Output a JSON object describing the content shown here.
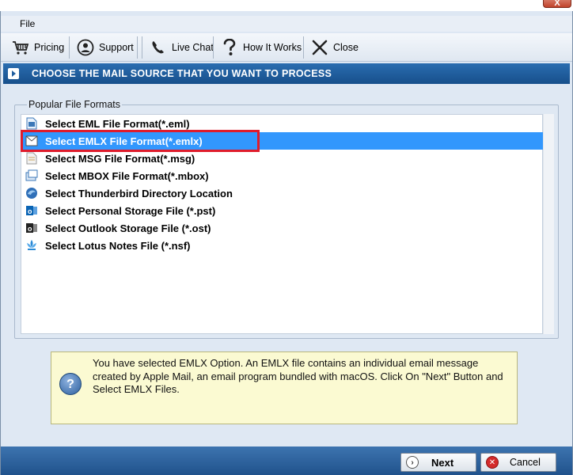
{
  "window": {
    "close_glyph": "X"
  },
  "menu": {
    "file": "File"
  },
  "toolbar": {
    "pricing": "Pricing",
    "support": "Support",
    "live_chat": "Live Chat",
    "how_it_works": "How It Works",
    "close": "Close"
  },
  "header": {
    "title": "CHOOSE THE MAIL SOURCE THAT YOU WANT TO PROCESS"
  },
  "group": {
    "title": "Popular File Formats"
  },
  "formats": [
    {
      "label": "Select EML File Format(*.eml)",
      "icon": "eml-file-icon",
      "selected": false
    },
    {
      "label": "Select EMLX File Format(*.emlx)",
      "icon": "emlx-file-icon",
      "selected": true
    },
    {
      "label": "Select MSG File Format(*.msg)",
      "icon": "msg-file-icon",
      "selected": false
    },
    {
      "label": "Select MBOX File Format(*.mbox)",
      "icon": "mbox-file-icon",
      "selected": false
    },
    {
      "label": "Select Thunderbird Directory Location",
      "icon": "thunderbird-icon",
      "selected": false
    },
    {
      "label": "Select Personal Storage File (*.pst)",
      "icon": "outlook-pst-icon",
      "selected": false
    },
    {
      "label": "Select Outlook Storage File (*.ost)",
      "icon": "outlook-ost-icon",
      "selected": false
    },
    {
      "label": "Select Lotus Notes File (*.nsf)",
      "icon": "lotus-notes-icon",
      "selected": false
    }
  ],
  "info": {
    "text": "You have selected EMLX Option. An EMLX file contains an individual email message created by Apple Mail, an email program bundled with macOS. Click On \"Next\" Button and Select EMLX Files."
  },
  "footer": {
    "next": "Next",
    "cancel": "Cancel"
  },
  "colors": {
    "header": "#1f5d9e",
    "selection": "#3297fd",
    "highlight_frame": "#e01c2b",
    "info_bg": "#fbfad2"
  }
}
